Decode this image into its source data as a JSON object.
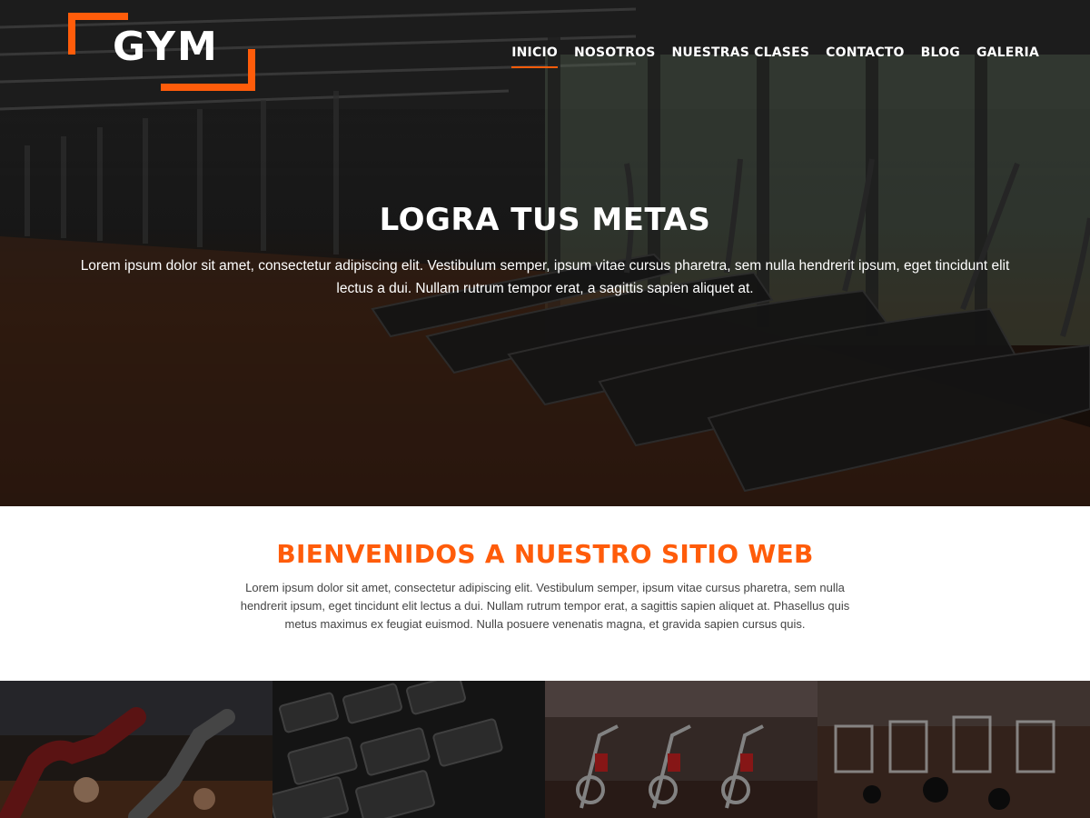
{
  "header": {
    "logo_text": "GYM",
    "nav": [
      {
        "label": "INICIO",
        "active": true
      },
      {
        "label": "NOSOTROS",
        "active": false
      },
      {
        "label": "NUESTRAS CLASES",
        "active": false
      },
      {
        "label": "CONTACTO",
        "active": false
      },
      {
        "label": "BLOG",
        "active": false
      },
      {
        "label": "GALERIA",
        "active": false
      }
    ]
  },
  "hero": {
    "title": "LOGRA TUS METAS",
    "text": "Lorem ipsum dolor sit amet, consectetur adipiscing elit. Vestibulum semper, ipsum vitae cursus pharetra, sem nulla hendrerit ipsum, eget tincidunt elit lectus a dui. Nullam rutrum tempor erat, a sagittis sapien aliquet at."
  },
  "welcome": {
    "title": "BIENVENIDOS A NUESTRO SITIO WEB",
    "text": "Lorem ipsum dolor sit amet, consectetur adipiscing elit. Vestibulum semper, ipsum vitae cursus pharetra, sem nulla hendrerit ipsum, eget tincidunt elit lectus a dui. Nullam rutrum tempor erat, a sagittis sapien aliquet at. Phasellus quis metus maximus ex feugiat euismod. Nulla posuere venenatis magna, et gravida sapien cursus quis."
  },
  "colors": {
    "accent": "#ff5c0a",
    "hero_overlay": "#000000",
    "text_light": "#ffffff",
    "text_body": "#444444"
  },
  "gallery": [
    {
      "icon": "stretching-class-photo"
    },
    {
      "icon": "dumbbell-rack-photo"
    },
    {
      "icon": "spinning-bikes-photo"
    },
    {
      "icon": "gym-floor-photo"
    }
  ]
}
